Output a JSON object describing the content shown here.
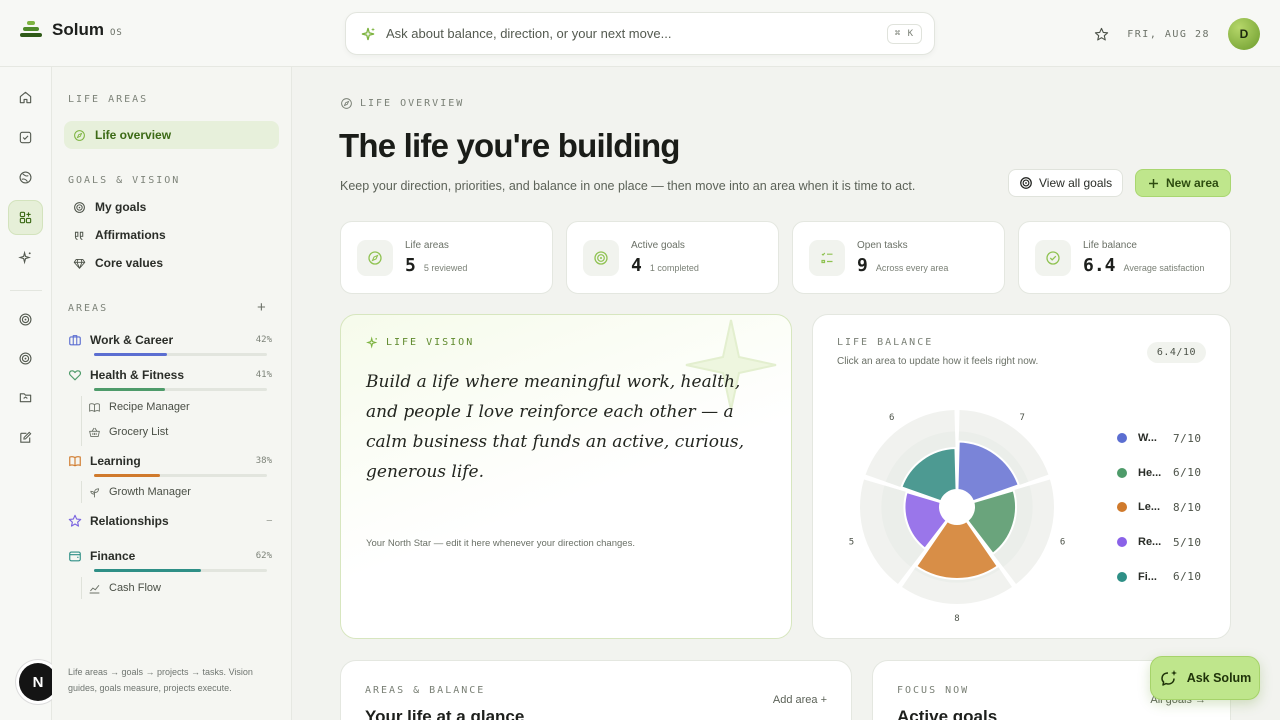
{
  "app": {
    "brand": "Solum",
    "brand_tag": "OS",
    "search_placeholder": "Ask about balance, direction, or your next move...",
    "shortcut": "⌘ K",
    "date": "FRI, AUG 28",
    "avatar_initial": "D",
    "n_badge": "N"
  },
  "sidebar": {
    "life_areas_label": "LIFE AREAS",
    "life_overview": "Life overview",
    "goals_label": "GOALS & VISION",
    "goals_items": [
      {
        "label": "My goals",
        "icon": "target-icon"
      },
      {
        "label": "Affirmations",
        "icon": "quote-icon"
      },
      {
        "label": "Core values",
        "icon": "diamond-icon"
      }
    ],
    "areas_label": "AREAS",
    "add": "+",
    "areas": [
      {
        "label": "Work & Career",
        "pct": "42%",
        "progress": 0.42,
        "color": "#5b6ed1"
      },
      {
        "label": "Health & Fitness",
        "pct": "41%",
        "progress": 0.41,
        "color": "#4e9b6a"
      },
      {
        "label": "Learning",
        "pct": "38%",
        "progress": 0.38,
        "color": "#d07a2c"
      },
      {
        "label": "Relationships",
        "pct": "—",
        "progress": 0,
        "color": "#7a64e0"
      },
      {
        "label": "Finance",
        "pct": "62%",
        "progress": 0.62,
        "color": "#2e8f86"
      }
    ],
    "subs": {
      "recipe": "Recipe Manager",
      "grocery": "Grocery List",
      "growth": "Growth Manager",
      "cash": "Cash Flow"
    },
    "footer": "Life areas → goals → projects → tasks. Vision guides, goals measure, projects execute."
  },
  "main": {
    "eyebrow": "LIFE OVERVIEW",
    "title": "The life you're building",
    "lead": "Keep your direction, priorities, and balance in one place — then move into an area when it is time to act.",
    "view_all": "View all goals",
    "new_area": "New area",
    "stats": [
      {
        "label": "Life areas",
        "value": "5",
        "sub": "5 reviewed",
        "icon": "compass-icon"
      },
      {
        "label": "Active goals",
        "value": "4",
        "sub": "1 completed",
        "icon": "target-icon"
      },
      {
        "label": "Open tasks",
        "value": "9",
        "sub": "Across every area",
        "icon": "checklist-icon"
      },
      {
        "label": "Life balance",
        "value": "6.4",
        "sub": "Average satisfaction",
        "icon": "check-circle-icon"
      }
    ],
    "vision": {
      "eyebrow": "LIFE VISION",
      "quote": "Build a life where meaningful work, health, and people I love reinforce each other — a calm business that funds an active, curious, generous life.",
      "footer": "Your North Star — edit it here whenever your direction changes."
    },
    "balance": {
      "eyebrow": "LIFE BALANCE",
      "subtitle": "Click an area to update how it feels right now.",
      "score": "6.4/10",
      "legend": [
        {
          "name": "W...",
          "value": "7/10",
          "color": "#5b6ed1"
        },
        {
          "name": "He...",
          "value": "6/10",
          "color": "#4e9b6a"
        },
        {
          "name": "Le...",
          "value": "8/10",
          "color": "#d07a2c"
        },
        {
          "name": "Re...",
          "value": "5/10",
          "color": "#8a62e8"
        },
        {
          "name": "Fi...",
          "value": "6/10",
          "color": "#2e8f86"
        }
      ]
    },
    "areas_card": {
      "eyebrow": "AREAS & BALANCE",
      "title": "Your life at a glance",
      "link": "Add area +"
    },
    "focus_card": {
      "eyebrow": "FOCUS NOW",
      "title": "Active goals",
      "link": "All goals →"
    },
    "ask_button": "Ask Solum"
  },
  "chart_data": {
    "type": "polar-area",
    "categories": [
      "Work & Career",
      "Health & Fitness",
      "Learning",
      "Relationships",
      "Finance"
    ],
    "values": [
      7,
      6,
      8,
      5,
      6
    ],
    "max": 10,
    "colors": [
      "#7a84d8",
      "#6aa47c",
      "#d88e47",
      "#9a76ea",
      "#4d9a92"
    ],
    "labels": [
      "7",
      "6",
      "8",
      "5",
      "6"
    ]
  }
}
